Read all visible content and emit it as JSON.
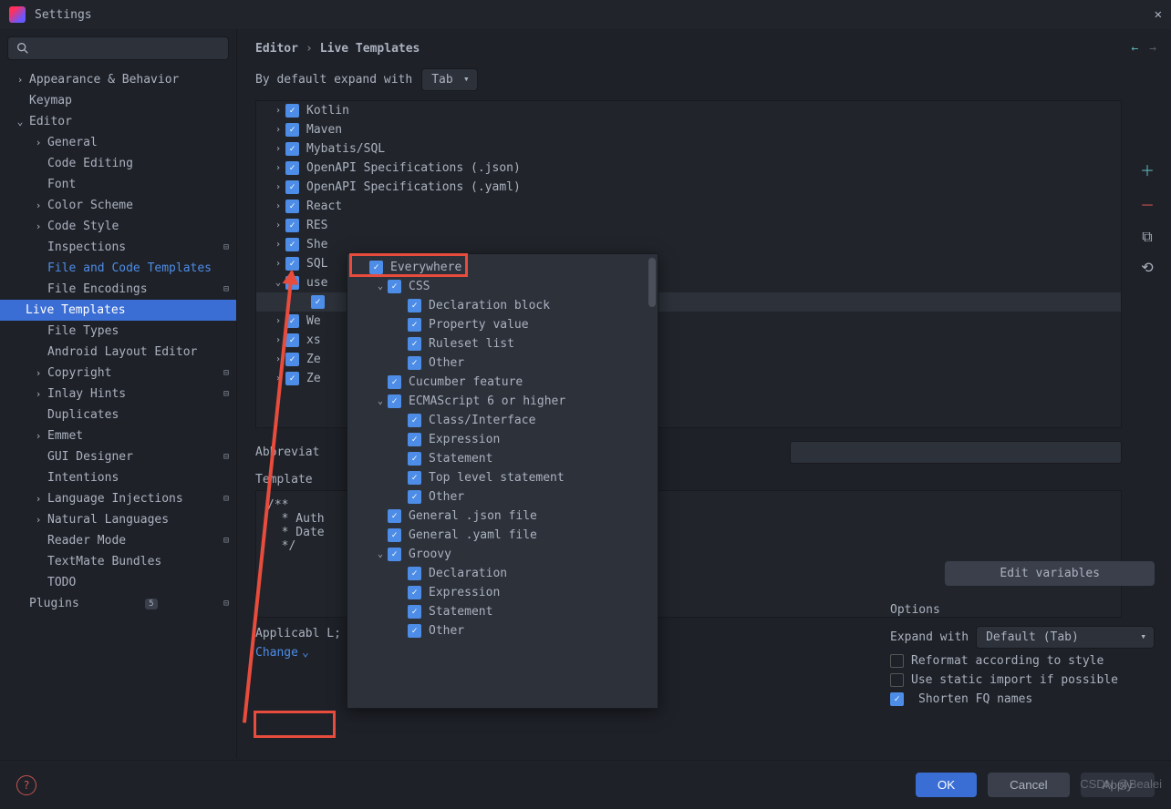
{
  "window": {
    "title": "Settings"
  },
  "breadcrumb": {
    "root": "Editor",
    "leaf": "Live Templates"
  },
  "sidebar": {
    "items": [
      {
        "label": "Appearance & Behavior",
        "chev": "›",
        "indent": 0
      },
      {
        "label": "Keymap",
        "chev": "",
        "indent": 0
      },
      {
        "label": "Editor",
        "chev": "⌄",
        "indent": 0
      },
      {
        "label": "General",
        "chev": "›",
        "indent": 1
      },
      {
        "label": "Code Editing",
        "chev": "",
        "indent": 1
      },
      {
        "label": "Font",
        "chev": "",
        "indent": 1
      },
      {
        "label": "Color Scheme",
        "chev": "›",
        "indent": 1
      },
      {
        "label": "Code Style",
        "chev": "›",
        "indent": 1
      },
      {
        "label": "Inspections",
        "chev": "",
        "indent": 1,
        "icon": "⊟"
      },
      {
        "label": "File and Code Templates",
        "chev": "",
        "indent": 1,
        "active": true
      },
      {
        "label": "File Encodings",
        "chev": "",
        "indent": 1,
        "icon": "⊟"
      },
      {
        "label": "Live Templates",
        "chev": "",
        "indent": 1,
        "selected": true
      },
      {
        "label": "File Types",
        "chev": "",
        "indent": 1
      },
      {
        "label": "Android Layout Editor",
        "chev": "",
        "indent": 1
      },
      {
        "label": "Copyright",
        "chev": "›",
        "indent": 1,
        "icon": "⊟"
      },
      {
        "label": "Inlay Hints",
        "chev": "›",
        "indent": 1,
        "icon": "⊟"
      },
      {
        "label": "Duplicates",
        "chev": "",
        "indent": 1
      },
      {
        "label": "Emmet",
        "chev": "›",
        "indent": 1
      },
      {
        "label": "GUI Designer",
        "chev": "",
        "indent": 1,
        "icon": "⊟"
      },
      {
        "label": "Intentions",
        "chev": "",
        "indent": 1
      },
      {
        "label": "Language Injections",
        "chev": "›",
        "indent": 1,
        "icon": "⊟"
      },
      {
        "label": "Natural Languages",
        "chev": "›",
        "indent": 1
      },
      {
        "label": "Reader Mode",
        "chev": "",
        "indent": 1,
        "icon": "⊟"
      },
      {
        "label": "TextMate Bundles",
        "chev": "",
        "indent": 1
      },
      {
        "label": "TODO",
        "chev": "",
        "indent": 1
      },
      {
        "label": "Plugins",
        "chev": "",
        "indent": 0,
        "badge": "5",
        "icon": "⊟"
      }
    ]
  },
  "expand": {
    "label": "By default expand with",
    "value": "Tab"
  },
  "templates_tree": [
    {
      "label": "Kotlin",
      "chev": "›"
    },
    {
      "label": "Maven",
      "chev": "›"
    },
    {
      "label": "Mybatis/SQL",
      "chev": "›"
    },
    {
      "label": "OpenAPI Specifications (.json)",
      "chev": "›"
    },
    {
      "label": "OpenAPI Specifications (.yaml)",
      "chev": "›"
    },
    {
      "label": "React",
      "chev": "›"
    },
    {
      "label": "RES",
      "chev": "›"
    },
    {
      "label": "She",
      "chev": "›"
    },
    {
      "label": "SQL",
      "chev": "›"
    },
    {
      "label": "use",
      "chev": "⌄"
    },
    {
      "label": "",
      "chev": "",
      "selected": true,
      "indent": true
    },
    {
      "label": "We",
      "chev": "›"
    },
    {
      "label": "xs",
      "chev": "›"
    },
    {
      "label": "Ze",
      "chev": "›"
    },
    {
      "label": "Ze",
      "chev": "›"
    }
  ],
  "form": {
    "abbrev_label": "Abbreviat",
    "template_label": "Template",
    "template_text": "/**\n  * Auth\n  * Date\n  */",
    "edit_vars": "Edit variables"
  },
  "options": {
    "heading": "Options",
    "expand_with_label": "Expand with",
    "expand_with_value": "Default (Tab)",
    "reformat": "Reformat according to style",
    "static_import": "Use static import if possible",
    "shorten": "Shorten FQ names"
  },
  "applicable": {
    "text": "Applicabl                                                  L; XML: XML text, XML tag;...",
    "change": "Change"
  },
  "popup": [
    {
      "label": "Everywhere",
      "i": 0
    },
    {
      "label": "CSS",
      "i": 1,
      "chev": "⌄"
    },
    {
      "label": "Declaration block",
      "i": 2
    },
    {
      "label": "Property value",
      "i": 2
    },
    {
      "label": "Ruleset list",
      "i": 2
    },
    {
      "label": "Other",
      "i": 2
    },
    {
      "label": "Cucumber feature",
      "i": 1
    },
    {
      "label": "ECMAScript 6 or higher",
      "i": 1,
      "chev": "⌄"
    },
    {
      "label": "Class/Interface",
      "i": 2
    },
    {
      "label": "Expression",
      "i": 2
    },
    {
      "label": "Statement",
      "i": 2
    },
    {
      "label": "Top level statement",
      "i": 2
    },
    {
      "label": "Other",
      "i": 2
    },
    {
      "label": "General .json file",
      "i": 1
    },
    {
      "label": "General .yaml file",
      "i": 1
    },
    {
      "label": "Groovy",
      "i": 1,
      "chev": "⌄"
    },
    {
      "label": "Declaration",
      "i": 2
    },
    {
      "label": "Expression",
      "i": 2
    },
    {
      "label": "Statement",
      "i": 2
    },
    {
      "label": "Other",
      "i": 2
    }
  ],
  "buttons": {
    "ok": "OK",
    "cancel": "Cancel",
    "apply": "Apply"
  },
  "watermark": "CSDN @Bealei"
}
